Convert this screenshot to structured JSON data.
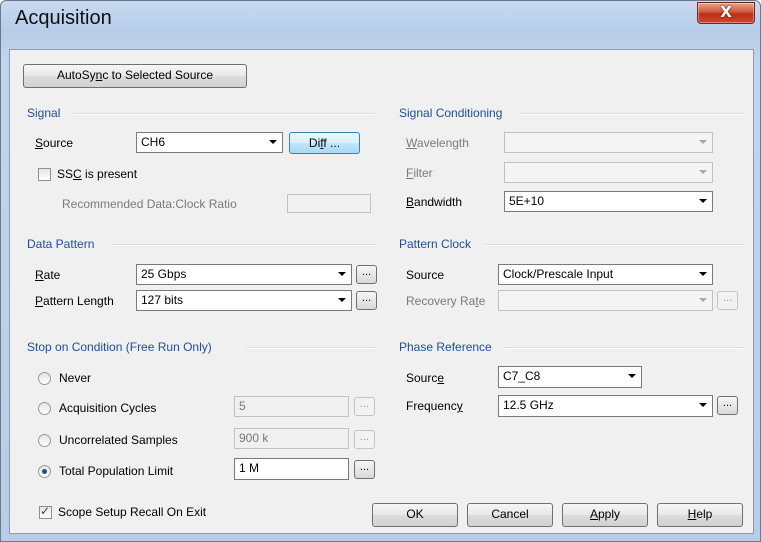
{
  "window": {
    "title": "Acquisition",
    "close_symbol": "X"
  },
  "autosync": {
    "label_pre": "AutoSy",
    "label_u": "n",
    "label_post": "c to Selected Source"
  },
  "signal": {
    "section": "Signal",
    "source_label_u": "S",
    "source_label_post": "ource",
    "source_value": "CH6",
    "diff_pre": "Di",
    "diff_u": "f",
    "diff_post": "f ...",
    "ssc_pre": "SS",
    "ssc_u": "C",
    "ssc_post": " is present",
    "ssc_checked": false,
    "ratio_label": "Recommended Data:Clock Ratio",
    "ratio_value": ""
  },
  "signal_conditioning": {
    "section": "Signal Conditioning",
    "wavelength_u": "W",
    "wavelength_post": "avelength",
    "wavelength_value": "",
    "filter_u": "F",
    "filter_post": "ilter",
    "filter_value": "",
    "bandwidth_u": "B",
    "bandwidth_post": "andwidth",
    "bandwidth_value": "5E+10"
  },
  "data_pattern": {
    "section": "Data Pattern",
    "rate_u": "R",
    "rate_post": "ate",
    "rate_value": "25 Gbps",
    "length_u": "P",
    "length_post": "attern Length",
    "length_value": "127 bits",
    "dots": "..."
  },
  "pattern_clock": {
    "section": "Pattern Clock",
    "source_label": "Source",
    "source_value": "Clock/Prescale Input",
    "recovery_pre": "Recovery Ra",
    "recovery_u": "t",
    "recovery_post": "e",
    "recovery_value": ""
  },
  "stop_condition": {
    "section": "Stop on Condition (Free Run Only)",
    "never": "Never",
    "acq_cycles": "Acquisition Cycles",
    "acq_cycles_value": "5",
    "uncorrelated": "Uncorrelated Samples",
    "uncorrelated_value": "900 k",
    "total_pop": "Total Population Limit",
    "total_pop_value": "1 M",
    "selected": "total_pop"
  },
  "phase_reference": {
    "section": "Phase Reference",
    "source_pre": "Sourc",
    "source_u": "e",
    "source_value": "C7_C8",
    "freq_pre": "Frequenc",
    "freq_u": "y",
    "freq_value": "12.5 GHz"
  },
  "footer": {
    "recall_label": "Scope Setup Recall On Exit",
    "recall_checked": true,
    "ok": "OK",
    "cancel": "Cancel",
    "apply_u": "A",
    "apply_post": "pply",
    "help_u": "H",
    "help_post": "elp"
  },
  "icons": {
    "check": "✓"
  }
}
